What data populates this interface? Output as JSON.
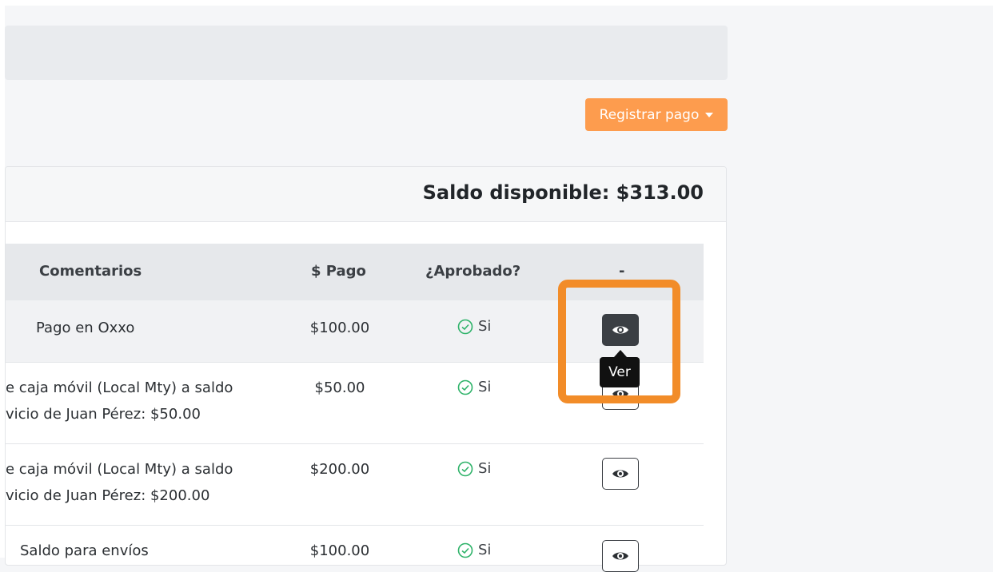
{
  "toolbar": {
    "register_label": "Registrar pago"
  },
  "card": {
    "saldo": "Saldo disponible: $313.00"
  },
  "table": {
    "headers": {
      "comentarios": "Comentarios",
      "pago": "$ Pago",
      "aprobado": "¿Aprobado?",
      "actions": "-"
    },
    "rows": [
      {
        "comment_line1": "Pago en Oxxo",
        "comment_line2": "",
        "pago": "$100.00",
        "aprobado": "Si"
      },
      {
        "comment_line1": "e caja móvil (Local Mty) a saldo",
        "comment_line2": "vicio de Juan Pérez: $50.00",
        "pago": "$50.00",
        "aprobado": "Si"
      },
      {
        "comment_line1": "e caja móvil (Local Mty) a saldo",
        "comment_line2": "vicio de Juan Pérez: $200.00",
        "pago": "$200.00",
        "aprobado": "Si"
      },
      {
        "comment_line1": "Saldo para envíos",
        "comment_line2": "",
        "pago": "$100.00",
        "aprobado": "Si"
      }
    ]
  },
  "tooltip": {
    "label": "Ver"
  },
  "colors": {
    "accent": "#fd9c4e",
    "highlight": "#f28c28",
    "approved": "#2fb36a"
  },
  "icons": {
    "view": "eye-icon",
    "approved": "check-circle-icon",
    "caret": "caret-down-icon"
  }
}
